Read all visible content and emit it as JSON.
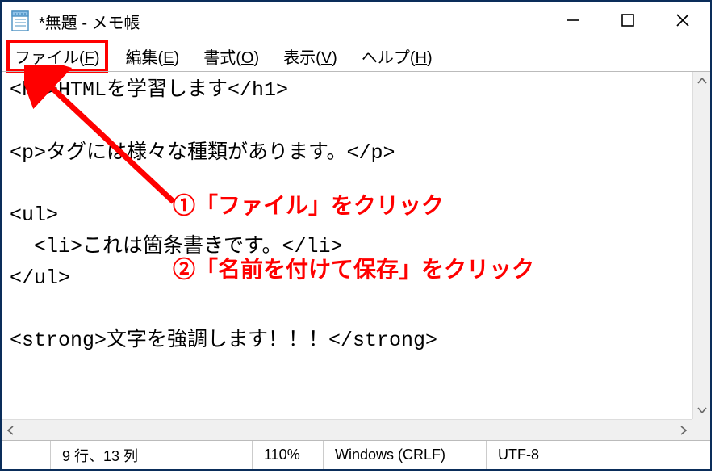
{
  "titlebar": {
    "title": "*無題 - メモ帳"
  },
  "menubar": {
    "file": {
      "label": "ファイル(",
      "accel": "F",
      "close": ")"
    },
    "edit": {
      "label": "編集(",
      "accel": "E",
      "close": ")"
    },
    "format": {
      "label": "書式(",
      "accel": "O",
      "close": ")"
    },
    "view": {
      "label": "表示(",
      "accel": "V",
      "close": ")"
    },
    "help": {
      "label": "ヘルプ(",
      "accel": "H",
      "close": ")"
    }
  },
  "editor": {
    "content": "<h1>HTMLを学習します</h1>\n\n<p>タグには様々な種類があります。</p>\n\n<ul>\n  <li>これは箇条書きです。</li>\n</ul>\n\n<strong>文字を強調します！！！</strong>"
  },
  "statusbar": {
    "position": "9 行、13 列",
    "zoom": "110%",
    "eol": "Windows (CRLF)",
    "encoding": "UTF-8"
  },
  "annotations": {
    "step1": "①「ファイル」をクリック",
    "step2": "②「名前を付けて保存」をクリック"
  }
}
